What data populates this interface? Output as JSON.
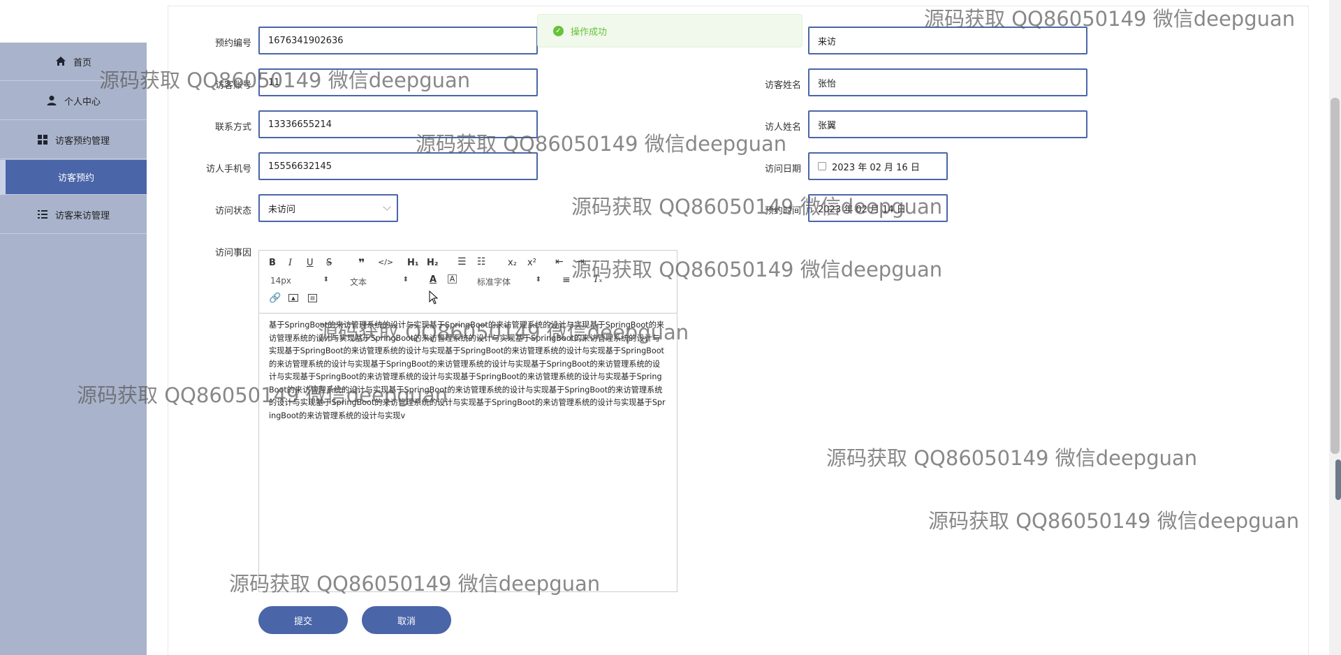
{
  "sidebar": {
    "items": [
      {
        "label": "首页",
        "icon": "home-icon"
      },
      {
        "label": "个人中心",
        "icon": "user-icon"
      },
      {
        "label": "访客预约管理",
        "icon": "grid-icon"
      },
      {
        "label": "访客预约",
        "icon": ""
      },
      {
        "label": "访客来访管理",
        "icon": "list-icon"
      }
    ]
  },
  "toast": {
    "text": "操作成功",
    "icon": "success-check-icon"
  },
  "form": {
    "booking_no": {
      "label": "预约编号",
      "value": "1676341902636"
    },
    "visit_type": {
      "value": "来访"
    },
    "visitor_account": {
      "label": "访客账号",
      "value": "11"
    },
    "visitor_name": {
      "label": "访客姓名",
      "value": "张怡"
    },
    "contact": {
      "label": "联系方式",
      "value": "13336655214"
    },
    "host_name": {
      "label": "访人姓名",
      "value": "张翼"
    },
    "host_phone": {
      "label": "访人手机号",
      "value": "15556632145"
    },
    "visit_date": {
      "label": "访问日期",
      "value": "2023 年 02 月 16 日"
    },
    "visit_status": {
      "label": "访问状态",
      "value": "未访问"
    },
    "booking_time": {
      "label": "预约时间",
      "value": "2023 年 02 月 14 日"
    },
    "reason": {
      "label": "访问事因"
    }
  },
  "editor": {
    "font_size": "14px",
    "block_type": "文本",
    "font_family": "标准字体",
    "content": "基于SpringBoot的来访管理系统的设计与实现基于SpringBoot的来访管理系统的设计与实现基于SpringBoot的来访管理系统的设计与实现基于SpringBoot的来访管理系统的设计与实现基于SpringBoot的来访管理系统的设计与实现基于SpringBoot的来访管理系统的设计与实现基于SpringBoot的来访管理系统的设计与实现基于SpringBoot的来访管理系统的设计与实现基于SpringBoot的来访管理系统的设计与实现基于SpringBoot的来访管理系统的设计与实现基于SpringBoot的来访管理系统的设计与实现基于SpringBoot的来访管理系统的设计与实现基于SpringBoot的来访管理系统的设计与实现基于SpringBoot的来访管理系统的设计与实现基于SpringBoot的来访管理系统的设计与实现基于SpringBoot的来访管理系统的设计与实现基于SpringBoot的来访管理系统的设计与实现基于SpringBoot的来访管理系统的设计与实现v"
  },
  "buttons": {
    "submit": "提交",
    "cancel": "取消"
  },
  "watermark": "源码获取 QQ86050149 微信deepguan",
  "colors": {
    "primary": "#4a65a8",
    "sidebar": "#a9b3cb",
    "success": "#67c23a"
  }
}
